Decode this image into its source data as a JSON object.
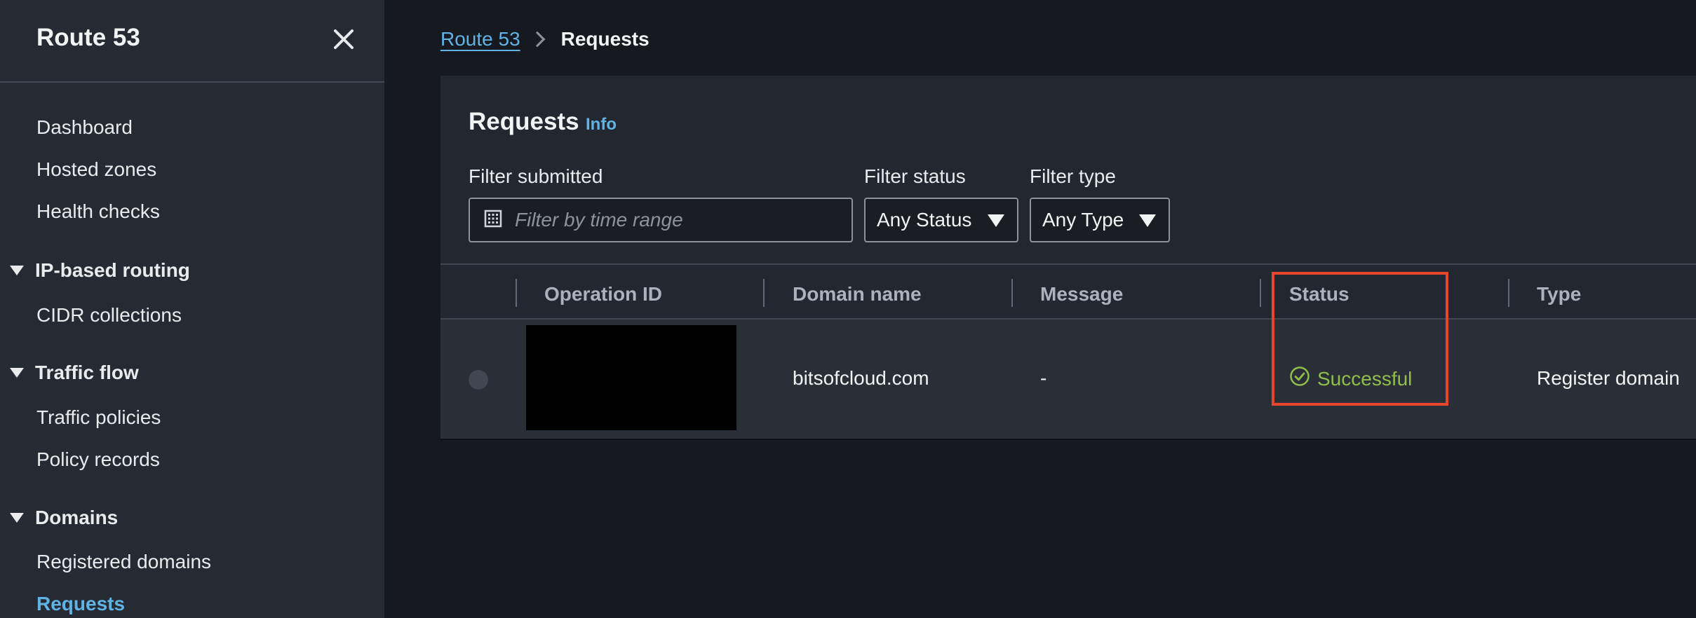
{
  "sidebar": {
    "title": "Route 53",
    "items": [
      {
        "label": "Dashboard"
      },
      {
        "label": "Hosted zones"
      },
      {
        "label": "Health checks"
      }
    ],
    "sections": [
      {
        "label": "IP-based routing",
        "items": [
          {
            "label": "CIDR collections"
          }
        ]
      },
      {
        "label": "Traffic flow",
        "items": [
          {
            "label": "Traffic policies"
          },
          {
            "label": "Policy records"
          }
        ]
      },
      {
        "label": "Domains",
        "items": [
          {
            "label": "Registered domains"
          },
          {
            "label": "Requests"
          }
        ]
      }
    ],
    "active_item": "Requests"
  },
  "breadcrumb": {
    "root": "Route 53",
    "current": "Requests"
  },
  "panel": {
    "title": "Requests",
    "info": "Info",
    "filters": {
      "submitted_label": "Filter submitted",
      "submitted_placeholder": "Filter by time range",
      "status_label": "Filter status",
      "status_value": "Any Status",
      "type_label": "Filter type",
      "type_value": "Any Type"
    },
    "table": {
      "columns": [
        "Operation ID",
        "Domain name",
        "Message",
        "Status",
        "Type"
      ],
      "rows": [
        {
          "operation_id": "",
          "domain_name": "bitsofcloud.com",
          "message": "-",
          "status": "Successful",
          "type": "Register domain"
        }
      ]
    }
  },
  "colors": {
    "accent_link": "#5fb3e5",
    "success": "#8fbf4a",
    "highlight_box": "#e8472e"
  }
}
